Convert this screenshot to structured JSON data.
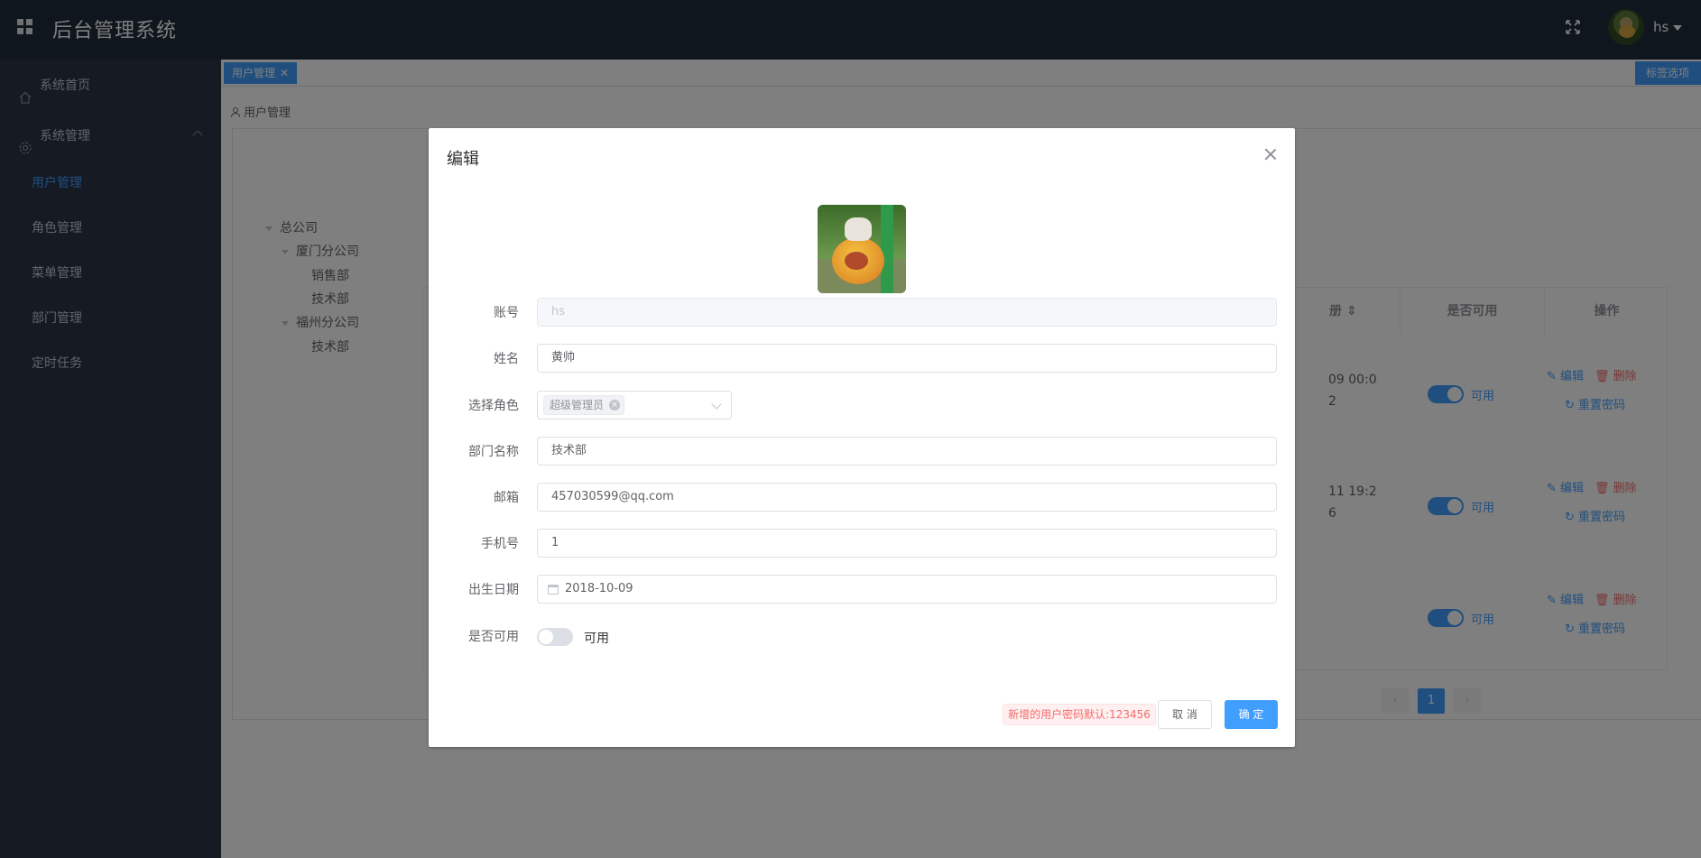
{
  "header": {
    "app_title": "后台管理系统",
    "username": "hs"
  },
  "sidebar": {
    "items": [
      {
        "label": "系统首页",
        "icon": "home-icon"
      },
      {
        "label": "系统管理",
        "icon": "gear-icon"
      }
    ],
    "sub_items": [
      {
        "label": "用户管理",
        "active": true
      },
      {
        "label": "角色管理"
      },
      {
        "label": "菜单管理"
      },
      {
        "label": "部门管理"
      },
      {
        "label": "定时任务"
      }
    ]
  },
  "tags": {
    "active_tag": "用户管理",
    "close": "✕",
    "options_label": "标签选项"
  },
  "breadcrumb": "用户管理",
  "tree": [
    {
      "label": "总公司"
    },
    {
      "label": "厦门分公司"
    },
    {
      "label": "销售部"
    },
    {
      "label": "技术部"
    },
    {
      "label": "福州分公司"
    },
    {
      "label": "技术部"
    }
  ],
  "table": {
    "headers": [
      "册",
      "是否可用",
      "操作"
    ],
    "rows": [
      {
        "date_1": "09 00:0",
        "date_2": "2",
        "status": "可用"
      },
      {
        "date_1": "11 19:2",
        "date_2": "6",
        "status": "可用"
      },
      {
        "date_1": "",
        "date_2": "",
        "status": "可用"
      }
    ],
    "edit": "编辑",
    "delete": "删除",
    "reset_pwd": "重置密码"
  },
  "pagination": {
    "current": "1"
  },
  "dialog": {
    "title": "编辑",
    "labels": {
      "account": "账号",
      "name": "姓名",
      "role": "选择角色",
      "dept": "部门名称",
      "email": "邮箱",
      "phone": "手机号",
      "birthday": "出生日期",
      "enabled": "是否可用"
    },
    "values": {
      "account": "hs",
      "name": "黄帅",
      "role_tag": "超级管理员",
      "dept": "技术部",
      "email": "457030599@qq.com",
      "phone": "1",
      "birthday": "2018-10-09",
      "enabled_label": "可用"
    },
    "enabled": false,
    "tip": "新增的用户密码默认:123456",
    "cancel": "取 消",
    "ok": "确 定"
  },
  "colors": {
    "primary": "#409eff",
    "danger": "#f56c6c",
    "header_bg": "#1f2d3d",
    "sidebar_bg": "#2a3547"
  }
}
